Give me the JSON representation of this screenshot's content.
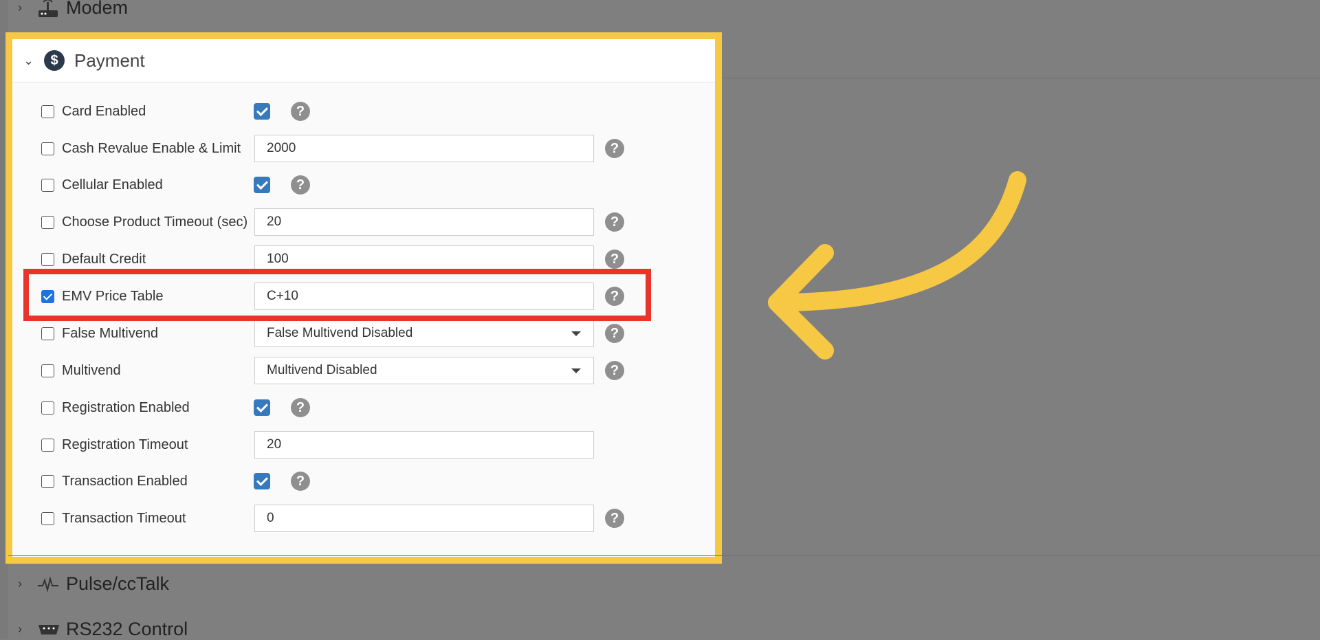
{
  "sections": {
    "modem": {
      "label": "Modem"
    },
    "pulse": {
      "label": "Pulse/ccTalk"
    },
    "rs232": {
      "label": "RS232 Control"
    }
  },
  "payment": {
    "title": "Payment",
    "rows": [
      {
        "label": "Card Enabled",
        "checked": false,
        "control": "checkbox",
        "help": true
      },
      {
        "label": "Cash Revalue Enable & Limit",
        "checked": false,
        "control": "input",
        "value": "2000",
        "help": true
      },
      {
        "label": "Cellular Enabled",
        "checked": false,
        "control": "checkbox",
        "help": true
      },
      {
        "label": "Choose Product Timeout (sec)",
        "checked": false,
        "control": "input",
        "value": "20",
        "help": true
      },
      {
        "label": "Default Credit",
        "checked": false,
        "control": "input",
        "value": "100",
        "help": true
      },
      {
        "label": "EMV Price Table",
        "checked": true,
        "control": "input",
        "value": "C+10",
        "help": true
      },
      {
        "label": "False Multivend",
        "checked": false,
        "control": "select",
        "value": "False Multivend Disabled",
        "help": true
      },
      {
        "label": "Multivend",
        "checked": false,
        "control": "select",
        "value": "Multivend Disabled",
        "help": true
      },
      {
        "label": "Registration Enabled",
        "checked": false,
        "control": "checkbox",
        "help": true
      },
      {
        "label": "Registration Timeout",
        "checked": false,
        "control": "input",
        "value": "20",
        "help": false
      },
      {
        "label": "Transaction Enabled",
        "checked": false,
        "control": "checkbox",
        "help": true
      },
      {
        "label": "Transaction Timeout",
        "checked": false,
        "control": "input",
        "value": "0",
        "help": true
      }
    ]
  },
  "icons": {
    "help": "?",
    "dollar": "$"
  },
  "colors": {
    "highlight_box": "#f6c844",
    "highlight_row": "#e8342a",
    "arrow": "#f6c844",
    "checkbox_blue": "#3679bd"
  }
}
